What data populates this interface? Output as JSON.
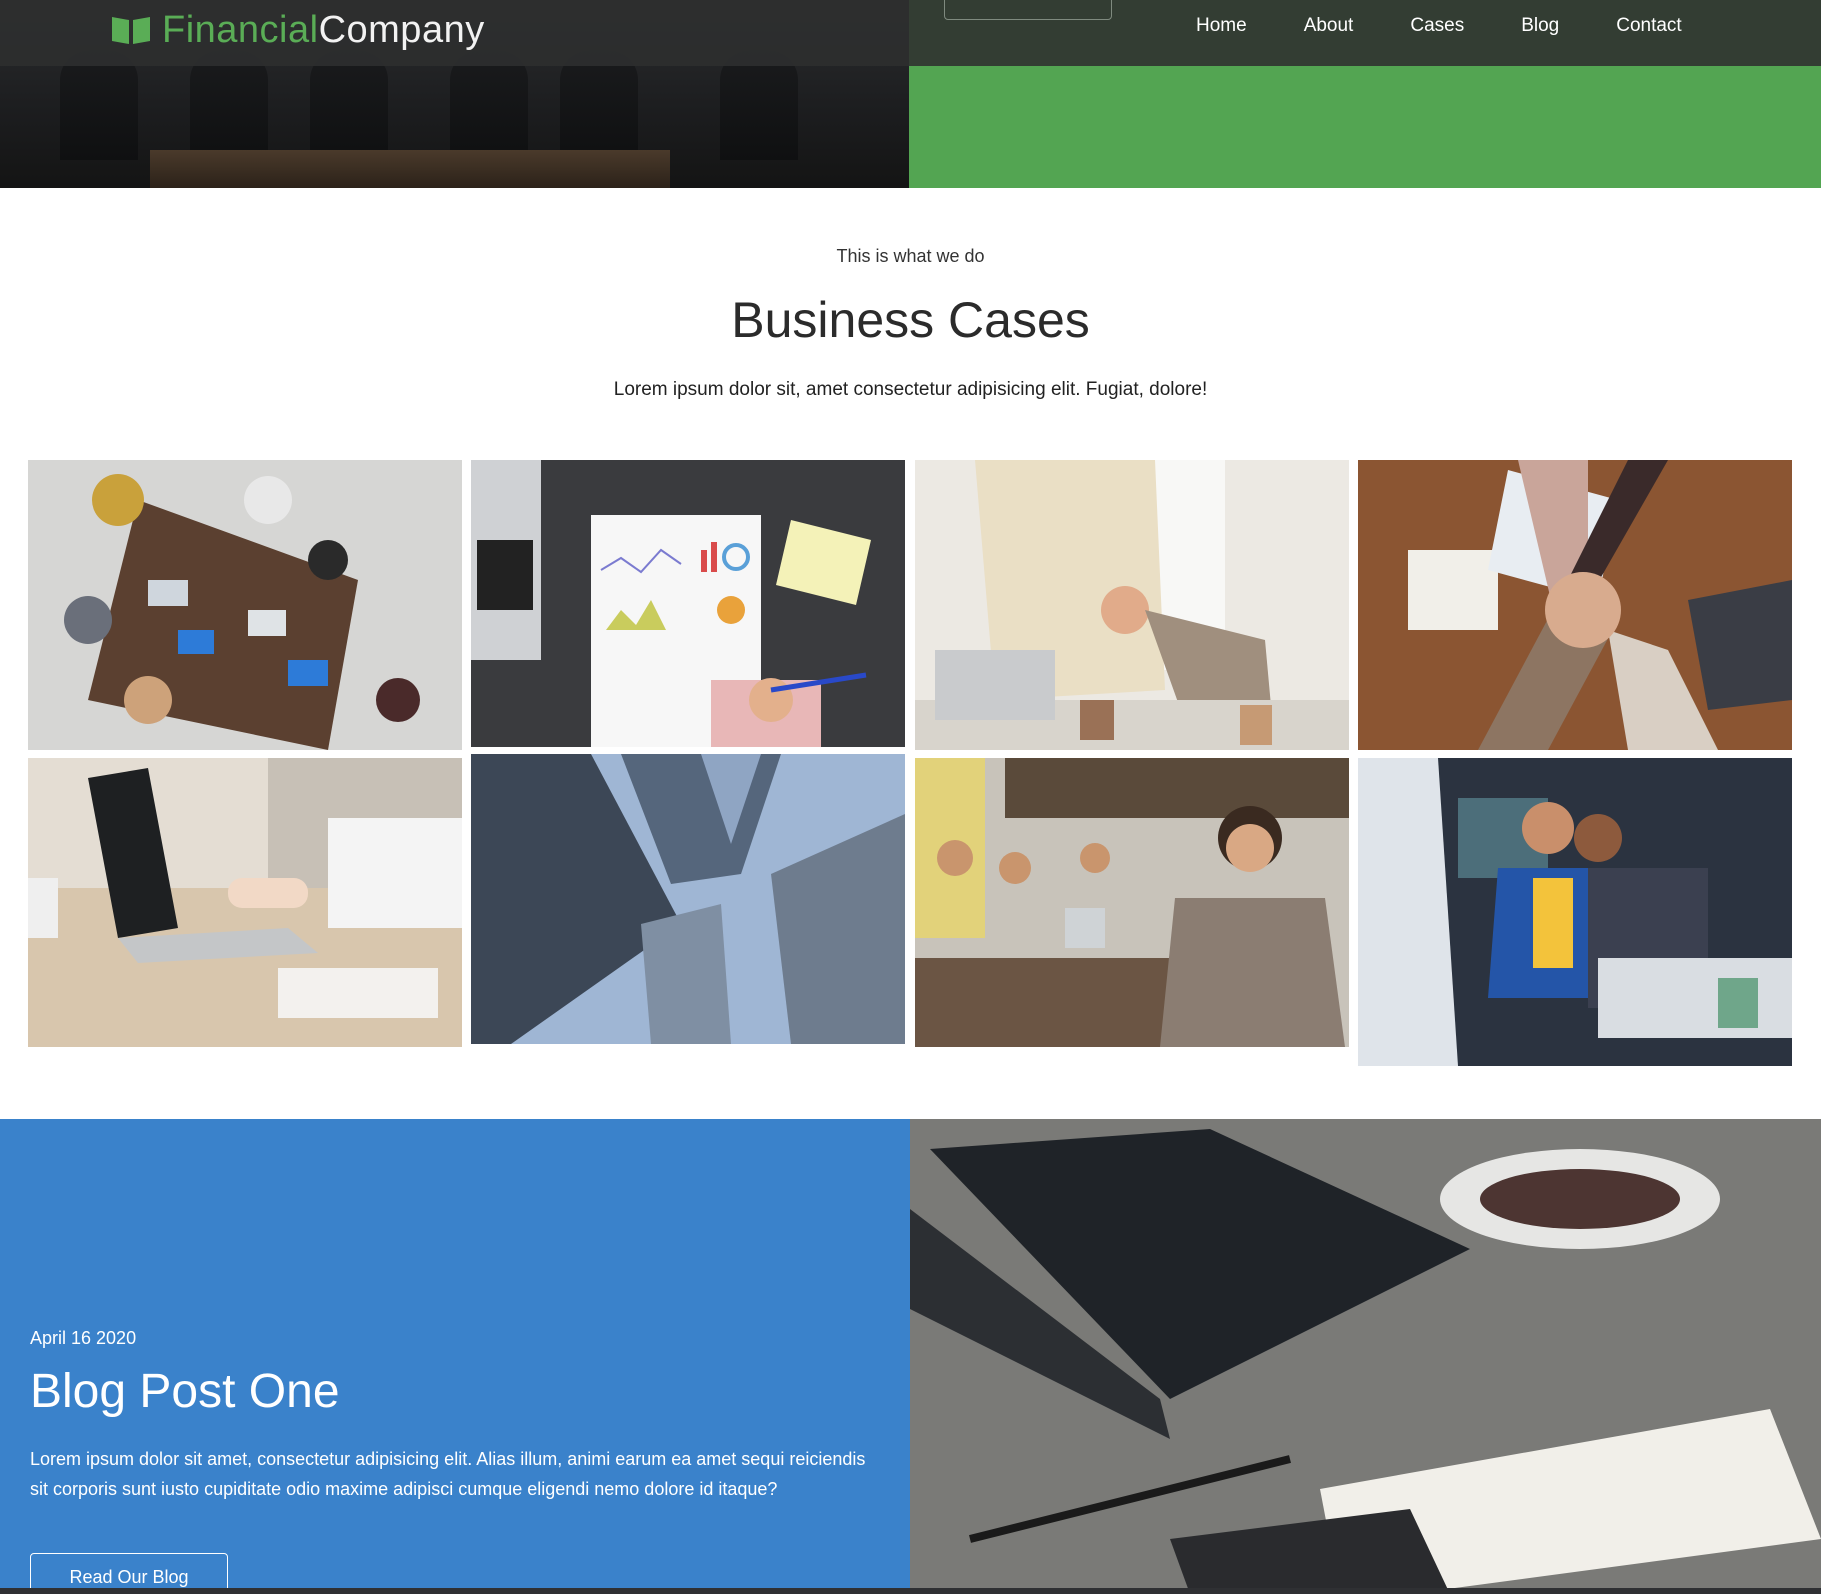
{
  "brand": {
    "part1": "Financial",
    "part2": "Company",
    "icon": "book-icon"
  },
  "nav": {
    "items": [
      "Home",
      "About",
      "Cases",
      "Blog",
      "Contact"
    ]
  },
  "hero": {
    "accent_color": "#53a552"
  },
  "cases": {
    "eyebrow": "This is what we do",
    "title": "Business Cases",
    "subtitle": "Lorem ipsum dolor sit, amet consectetur adipisicing elit. Fugiat, dolore!"
  },
  "blog": {
    "date": "April 16 2020",
    "title": "Blog Post One",
    "text": "Lorem ipsum dolor sit amet, consectetur adipisicing elit. Alias illum, animi earum ea amet sequi reiciendis sit corporis sunt iusto cupiditate odio maxime adipisci cumque eligendi nemo dolore id itaque?",
    "button": "Read Our Blog",
    "background_color": "#3a82cb"
  }
}
